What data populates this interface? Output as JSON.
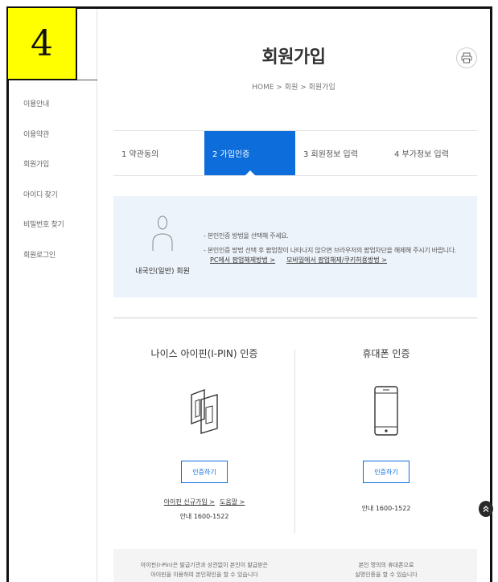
{
  "step_badge": "4",
  "sidebar": {
    "items": [
      {
        "label": "이용안내"
      },
      {
        "label": "이용약관"
      },
      {
        "label": "회원가입"
      },
      {
        "label": "아이디 찾기"
      },
      {
        "label": "비밀번호 찾기"
      },
      {
        "label": "회원로그인"
      }
    ]
  },
  "header": {
    "title": "회원가입",
    "breadcrumb": "HOME > 회원 > 회원가입",
    "print_icon": "print-icon"
  },
  "steps": [
    {
      "label": "1 약관동의",
      "active": false
    },
    {
      "label": "2 가입인증",
      "active": true
    },
    {
      "label": "3 회원정보 입력",
      "active": false
    },
    {
      "label": "4 부가정보 입력",
      "active": false
    }
  ],
  "notice": {
    "member_label": "내국인(일반) 회원",
    "line1": "- 본인인증 방법을 선택해 주세요.",
    "line2": "- 본인인증 방법 선택 후 팝업창이 나타나지 않으면 브라우저의 팝업차단을 해제해 주시기 바랍니다.",
    "link_pc": "PC에서 팝업해제방법 >",
    "link_mobile": "모바일에서 팝업해제/쿠키허용방법 >"
  },
  "auth": {
    "ipin": {
      "title": "나이스 아이핀(I-PIN) 인증",
      "button": "인증하기",
      "link_signup": "아이핀 신규가입 >",
      "link_help": "도움말 >",
      "phone": "안내 1600-1522"
    },
    "phone": {
      "title": "휴대폰 인증",
      "button": "인증하기",
      "phone": "안내 1600-1522"
    }
  },
  "footer_band": {
    "left_line1": "아이핀(I-Pin)은 발급기관과 상관없이 본인이 발급받은",
    "left_line2": "아이핀을 이용하여 본인확인을 할 수 있습니다",
    "right_line1": "본인 명의의 휴대폰으로",
    "right_line2": "실명인증을 할 수 있습니다"
  },
  "colors": {
    "accent": "#0d6edb",
    "badge": "#ffff00",
    "notice_bg": "#edf3fa"
  }
}
